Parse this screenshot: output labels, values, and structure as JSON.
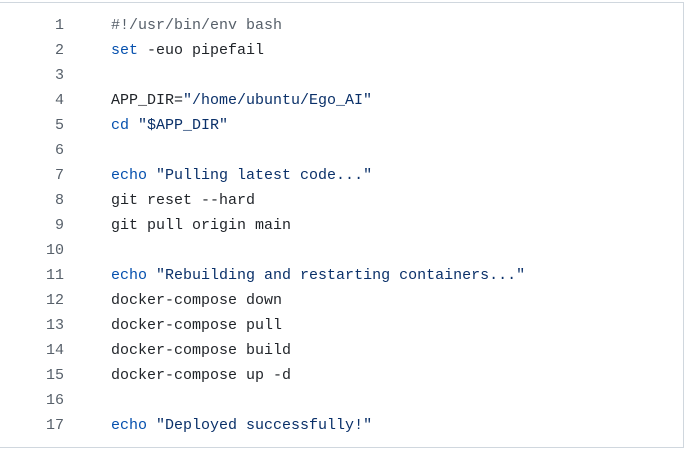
{
  "colors": {
    "background": "#ffffff",
    "border": "#d0d7de",
    "line_number": "#57606a",
    "comment": "#57606a",
    "keyword": "#0550ae",
    "string": "#0a3069",
    "text": "#1f2328"
  },
  "code": {
    "language": "bash",
    "lines": [
      {
        "number": "1",
        "tokens": [
          {
            "type": "comment",
            "text": "#!/usr/bin/env bash"
          }
        ]
      },
      {
        "number": "2",
        "tokens": [
          {
            "type": "keyword",
            "text": "set"
          },
          {
            "type": "plain",
            "text": " -euo pipefail"
          }
        ]
      },
      {
        "number": "3",
        "tokens": []
      },
      {
        "number": "4",
        "tokens": [
          {
            "type": "plain",
            "text": "APP_DIR="
          },
          {
            "type": "string",
            "text": "\"/home/ubuntu/Ego_AI\""
          }
        ]
      },
      {
        "number": "5",
        "tokens": [
          {
            "type": "keyword",
            "text": "cd"
          },
          {
            "type": "plain",
            "text": " "
          },
          {
            "type": "string",
            "text": "\"$APP_DIR\""
          }
        ]
      },
      {
        "number": "6",
        "tokens": []
      },
      {
        "number": "7",
        "tokens": [
          {
            "type": "keyword",
            "text": "echo"
          },
          {
            "type": "plain",
            "text": " "
          },
          {
            "type": "string",
            "text": "\"Pulling latest code...\""
          }
        ]
      },
      {
        "number": "8",
        "tokens": [
          {
            "type": "plain",
            "text": "git reset --hard"
          }
        ]
      },
      {
        "number": "9",
        "tokens": [
          {
            "type": "plain",
            "text": "git pull origin main"
          }
        ]
      },
      {
        "number": "10",
        "tokens": []
      },
      {
        "number": "11",
        "tokens": [
          {
            "type": "keyword",
            "text": "echo"
          },
          {
            "type": "plain",
            "text": " "
          },
          {
            "type": "string",
            "text": "\"Rebuilding and restarting containers...\""
          }
        ]
      },
      {
        "number": "12",
        "tokens": [
          {
            "type": "plain",
            "text": "docker-compose down"
          }
        ]
      },
      {
        "number": "13",
        "tokens": [
          {
            "type": "plain",
            "text": "docker-compose pull"
          }
        ]
      },
      {
        "number": "14",
        "tokens": [
          {
            "type": "plain",
            "text": "docker-compose build"
          }
        ]
      },
      {
        "number": "15",
        "tokens": [
          {
            "type": "plain",
            "text": "docker-compose up -d"
          }
        ]
      },
      {
        "number": "16",
        "tokens": []
      },
      {
        "number": "17",
        "tokens": [
          {
            "type": "keyword",
            "text": "echo"
          },
          {
            "type": "plain",
            "text": " "
          },
          {
            "type": "string",
            "text": "\"Deployed successfully!\""
          }
        ]
      }
    ]
  }
}
